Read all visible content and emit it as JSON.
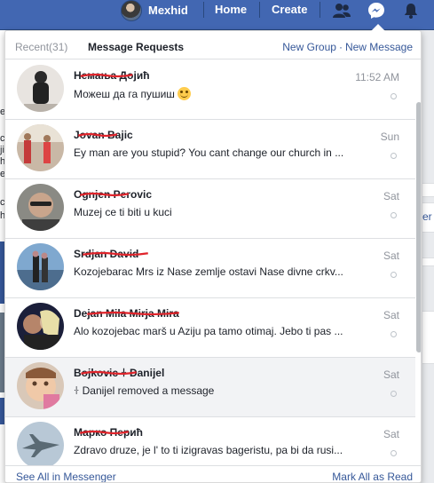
{
  "nav": {
    "profile_name": "Mexhid",
    "home": "Home",
    "create": "Create",
    "icons": [
      "friend-requests-icon",
      "messenger-icon",
      "notifications-icon"
    ]
  },
  "background": {
    "left_chars": [
      "e",
      "c",
      "ji",
      "hi",
      "e",
      "ci",
      "h"
    ],
    "right_chars": [
      "er"
    ]
  },
  "header": {
    "recent_label": "Recent",
    "recent_count": "(31)",
    "requests_label": "Message Requests",
    "new_group": "New Group",
    "separator": "·",
    "new_message": "New Message"
  },
  "messages": [
    {
      "name": "Немања Дојић",
      "snippet": "Можеш да га пушиш",
      "time": "11:52 AM",
      "emoji": "smile-emoji"
    },
    {
      "name": "Jovan Bajic",
      "snippet": "Ey man are you stupid? You cant change our church in ...",
      "time": "Sun"
    },
    {
      "name": "Ognjen Perovic",
      "snippet": "Muzej ce ti biti u kuci",
      "time": "Sat"
    },
    {
      "name": "Srdjan David",
      "snippet": "Kozojebarac Mrs iz Nase zemlje ostavi Nase divne crkv...",
      "time": "Sat"
    },
    {
      "name": "Dejan Mila Mirja Mira",
      "snippet": "Alo kozojebac marš u Aziju pa tamo otimaj. Jebo ti pas ...",
      "time": "Sat"
    },
    {
      "name": "Bojkovic ꖌ Danijel",
      "snippet": "ꖌ Danijel removed a message",
      "time": "Sat"
    },
    {
      "name": "Марко Перић",
      "snippet": "Zdravo druze, je l' to ti izigravas bageristu, pa bi da rusi...",
      "time": "Sat"
    }
  ],
  "footer": {
    "see_all": "See All in Messenger",
    "mark_all": "Mark All as Read"
  },
  "colors": {
    "navbar": "#4267b2",
    "link": "#365899",
    "redaction": "#e0242b"
  }
}
